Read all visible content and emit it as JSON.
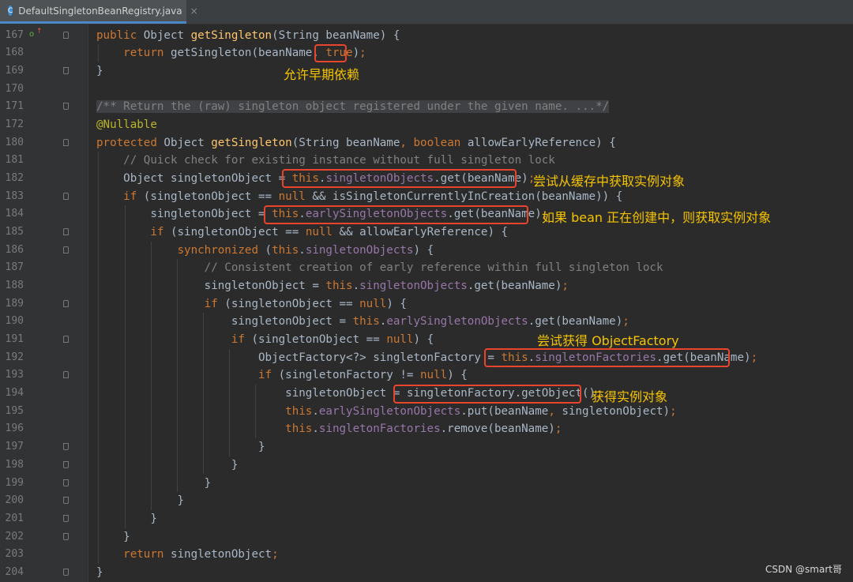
{
  "tab": {
    "name": "DefaultSingletonBeanRegistry.java",
    "close": "×",
    "icon": "java-class-icon"
  },
  "lines": [
    {
      "n": "167",
      "html": "<span class='kw'>public</span> Object <span class='fn'>getSingleton</span>(String beanName) {"
    },
    {
      "n": "168",
      "html": "    <span class='kw'>return</span> getSingleton(beanName, <span class='kw'>true</span>)<span class='kw'>;</span>"
    },
    {
      "n": "169",
      "html": "}"
    },
    {
      "n": "170",
      "html": ""
    },
    {
      "n": "171",
      "html": "<span class='dc'>/** Return the (raw) singleton object registered under the given name. ...*/</span>"
    },
    {
      "n": "172",
      "html": "<span class='an'>@Nullable</span>"
    },
    {
      "n": "180",
      "html": "<span class='kw'>protected</span> Object <span class='fn'>getSingleton</span>(String beanName<span class='kw'>,</span> <span class='kw'>boolean</span> allowEarlyReference) {"
    },
    {
      "n": "181",
      "html": "    <span class='cm'>// Quick check for existing instance without full singleton lock</span>"
    },
    {
      "n": "182",
      "html": "    Object singletonObject = <span class='kw'>this</span>.<span class='fl'>singletonObjects</span>.get(beanName)<span class='kw'>;</span>"
    },
    {
      "n": "183",
      "html": "    <span class='kw'>if</span> (singletonObject == <span class='kw'>null</span> && isSingletonCurrentlyInCreation(beanName)) {"
    },
    {
      "n": "184",
      "html": "        singletonObject = <span class='kw'>this</span>.<span class='fl'>earlySingletonObjects</span>.get(beanName)<span class='kw'>;</span>"
    },
    {
      "n": "185",
      "html": "        <span class='kw'>if</span> (singletonObject == <span class='kw'>null</span> && allowEarlyReference) {"
    },
    {
      "n": "186",
      "html": "            <span class='kw'>synchronized</span> (<span class='kw'>this</span>.<span class='fl'>singletonObjects</span>) {"
    },
    {
      "n": "187",
      "html": "                <span class='cm'>// Consistent creation of early reference within full singleton lock</span>"
    },
    {
      "n": "188",
      "html": "                singletonObject = <span class='kw'>this</span>.<span class='fl'>singletonObjects</span>.get(beanName)<span class='kw'>;</span>"
    },
    {
      "n": "189",
      "html": "                <span class='kw'>if</span> (singletonObject == <span class='kw'>null</span>) {"
    },
    {
      "n": "190",
      "html": "                    singletonObject = <span class='kw'>this</span>.<span class='fl'>earlySingletonObjects</span>.get(beanName)<span class='kw'>;</span>"
    },
    {
      "n": "191",
      "html": "                    <span class='kw'>if</span> (singletonObject == <span class='kw'>null</span>) {"
    },
    {
      "n": "192",
      "html": "                        ObjectFactory&lt;?&gt; singletonFactory = <span class='kw'>this</span>.<span class='fl'>singletonFactories</span>.get(beanName)<span class='kw'>;</span>"
    },
    {
      "n": "193",
      "html": "                        <span class='kw'>if</span> (singletonFactory != <span class='kw'>null</span>) {"
    },
    {
      "n": "194",
      "html": "                            singletonObject = singletonFactory.getObject()<span class='kw'>;</span>"
    },
    {
      "n": "195",
      "html": "                            <span class='kw'>this</span>.<span class='fl'>earlySingletonObjects</span>.put(beanName<span class='kw'>,</span> singletonObject)<span class='kw'>;</span>"
    },
    {
      "n": "196",
      "html": "                            <span class='kw'>this</span>.<span class='fl'>singletonFactories</span>.remove(beanName)<span class='kw'>;</span>"
    },
    {
      "n": "197",
      "html": "                        }"
    },
    {
      "n": "198",
      "html": "                    }"
    },
    {
      "n": "199",
      "html": "                }"
    },
    {
      "n": "200",
      "html": "            }"
    },
    {
      "n": "201",
      "html": "        }"
    },
    {
      "n": "202",
      "html": "    }"
    },
    {
      "n": "203",
      "html": "    <span class='kw'>return</span> singletonObject<span class='kw'>;</span>"
    },
    {
      "n": "204",
      "html": "}"
    }
  ],
  "notes": {
    "n1": "允许早期依赖",
    "n2": "尝试从缓存中获取实例对象",
    "n3": "如果 bean 正在创建中，则获取实例对象",
    "n4": "尝试获得 ObjectFactory",
    "n5": "获得实例对象"
  },
  "watermark": "CSDN @smart哥",
  "colors": {
    "keyword": "#cc7832",
    "method": "#ffc66d",
    "field": "#9876aa",
    "highlight": "#e8442e",
    "annotation_text": "#f5c400"
  }
}
